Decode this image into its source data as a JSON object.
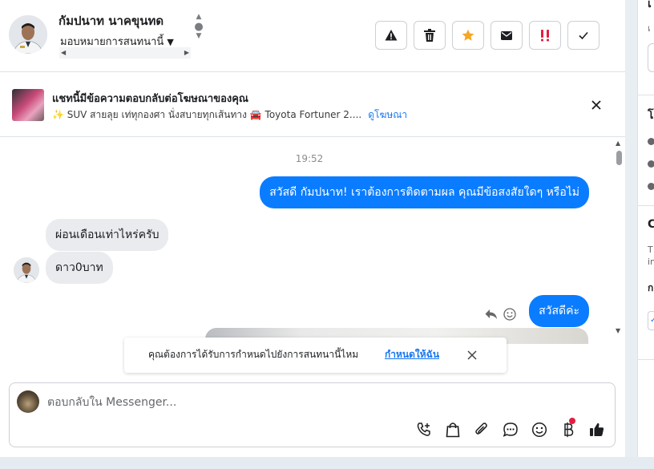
{
  "header": {
    "contact_name": "กัมปนาท นาคขุนทด",
    "assign_label": "มอบหมายการสนทนานี้"
  },
  "toolbar": {
    "buttons": [
      {
        "name": "report-spam",
        "icon": "warning-icon",
        "color": "#1c1e21"
      },
      {
        "name": "delete",
        "icon": "trash-icon",
        "color": "#1c1e21"
      },
      {
        "name": "star",
        "icon": "star-icon",
        "color": "#f5a623"
      },
      {
        "name": "mark-unread",
        "icon": "envelope-icon",
        "color": "#1c1e21"
      },
      {
        "name": "follow-up",
        "icon": "double-exclamation-icon",
        "color": "#e41e3f"
      },
      {
        "name": "done",
        "icon": "check-icon",
        "color": "#1c1e21"
      }
    ]
  },
  "ad_banner": {
    "title": "แชทนี้มีข้อความตอบกลับต่อโฆษณาของคุณ",
    "subtitle": "✨ SUV สายลุย เท่ทุกองศา นั่งสบายทุกเส้นทาง 🚘 Toyota Fortuner 2....",
    "link": "ดูโฆษณา"
  },
  "chat": {
    "timestamp": "19:52",
    "messages": [
      {
        "direction": "out",
        "text": "สวัสดี กัมปนาท! เราต้องการติดตามผล คุณมีข้อสงสัยใดๆ หรือไม่"
      },
      {
        "direction": "in",
        "text": "ผ่อนเดือนเท่าไหร่ครับ"
      },
      {
        "direction": "in",
        "text": "ดาว0บาท"
      },
      {
        "direction": "out",
        "text": "สวัสดีค่ะ"
      }
    ]
  },
  "notice": {
    "text": "คุณต้องการได้รับการกำหนดไปยังการสนทนานี้ไหม",
    "link": "กำหนดให้ฉัน"
  },
  "composer": {
    "placeholder": "ตอบกลับใน Messenger...",
    "icons": [
      "call-add-icon",
      "shopping-bag-icon",
      "attachment-icon",
      "saved-reply-icon",
      "emoji-icon",
      "baht-payment-icon",
      "thumbs-up-icon"
    ]
  },
  "colors": {
    "accent": "#0a7cff",
    "link": "#1877f2",
    "alert": "#e41e3f"
  }
}
